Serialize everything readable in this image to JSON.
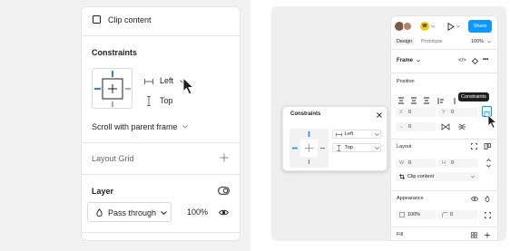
{
  "left_panel": {
    "clip_content_label": "Clip content",
    "constraints_title": "Constraints",
    "horizontal_constraint": "Left",
    "vertical_constraint": "Top",
    "scroll_label": "Scroll with parent frame",
    "layout_grid_label": "Layout Grid",
    "layer_title": "Layer",
    "blend_mode": "Pass through",
    "opacity": "100%"
  },
  "right_panel": {
    "header": {
      "share_label": "Share",
      "avatar_initial": "W",
      "tabs": [
        "Design",
        "Prototype"
      ],
      "zoom": "100%"
    },
    "frame_label": "Frame",
    "position_title": "Position",
    "tooltip": "Constraints",
    "x_label": "X",
    "x_value": "0",
    "y_label": "Y",
    "y_value": "0",
    "rotation_value": "0",
    "layout_title": "Layout",
    "w_label": "W",
    "w_value": "0",
    "h_label": "H",
    "h_value": "0",
    "clip_content_label": "Clip content",
    "appearance_title": "Appearance",
    "opacity_value": "100%",
    "radius_value": "0",
    "fill_title": "Fill"
  },
  "popup": {
    "title": "Constraints",
    "horizontal": "Left",
    "vertical": "Top"
  },
  "colors": {
    "accent": "#0d99ff",
    "constraint_blue": "#1e88e5",
    "tooltip_bg": "#1e1e1e"
  }
}
